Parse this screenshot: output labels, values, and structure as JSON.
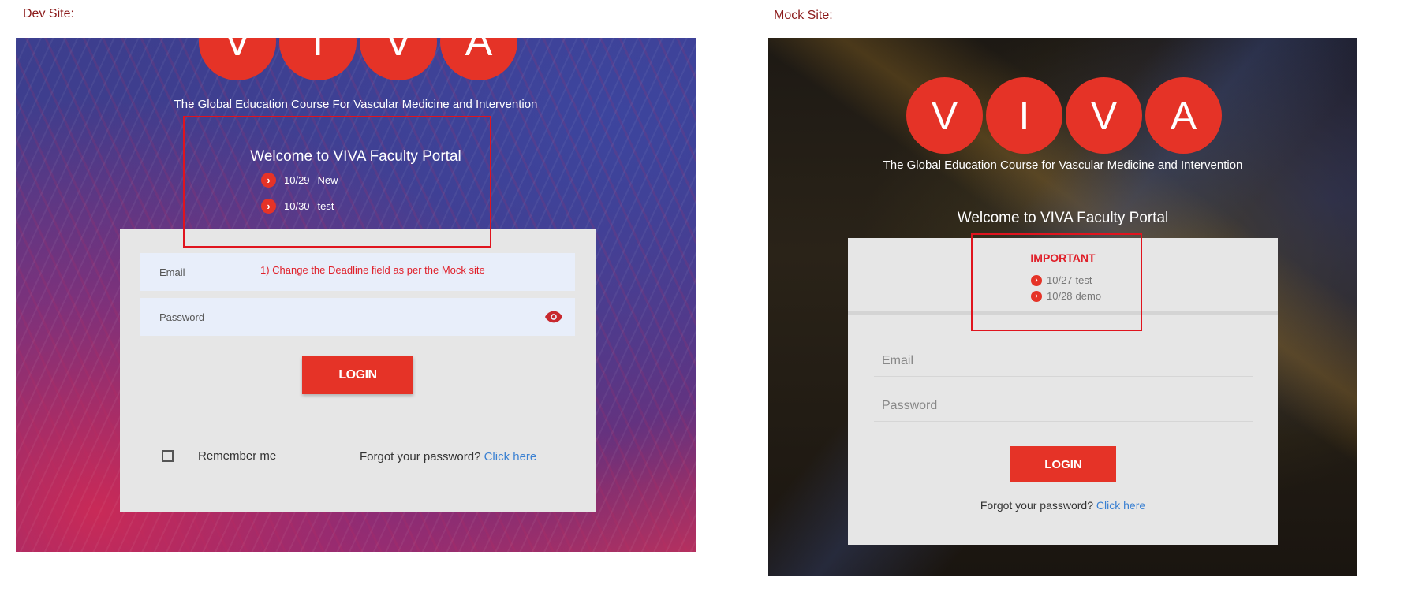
{
  "labels": {
    "dev": "Dev Site:",
    "mock": "Mock Site:"
  },
  "dev": {
    "logo_letters": [
      "V",
      "I",
      "V",
      "A"
    ],
    "tagline": "The Global Education Course For Vascular Medicine and Intervention",
    "welcome": "Welcome to VIVA Faculty Portal",
    "deadlines": [
      {
        "date": "10/29",
        "text": "New"
      },
      {
        "date": "10/30",
        "text": "test"
      }
    ],
    "email_label": "Email",
    "annotation": "1) Change the Deadline field as per the Mock site",
    "password_label": "Password",
    "login_label": "LOGIN",
    "remember_label": "Remember me",
    "forgot_text": "Forgot your password?",
    "forgot_link": "Click here"
  },
  "mock": {
    "logo_letters": [
      "V",
      "I",
      "V",
      "A"
    ],
    "tagline": "The Global Education Course for Vascular Medicine and Intervention",
    "welcome": "Welcome to VIVA Faculty Portal",
    "important_label": "IMPORTANT",
    "deadlines": [
      {
        "date": "10/27",
        "text": "test"
      },
      {
        "date": "10/28",
        "text": "demo"
      }
    ],
    "email_placeholder": "Email",
    "password_placeholder": "Password",
    "login_label": "LOGIN",
    "forgot_text": "Forgot your password?",
    "forgot_link": "Click here"
  },
  "colors": {
    "brand_red": "#e53327",
    "annotation_red": "#e0141e",
    "link_blue": "#3a80d2"
  }
}
